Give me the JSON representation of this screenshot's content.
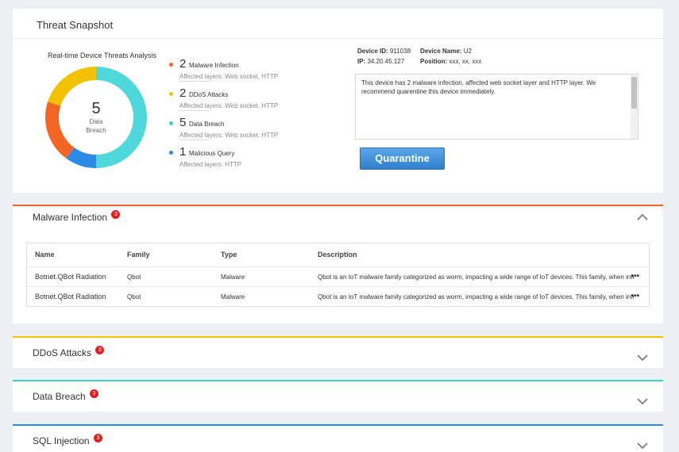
{
  "snapshot": {
    "title": "Threat Snapshot",
    "chart_data": {
      "type": "pie",
      "title": "Real-time Device Threats Analysis",
      "center_value": "5",
      "center_label_1": "Data",
      "center_label_2": "Breach",
      "slices": [
        {
          "name": "Data Breach",
          "value": 5,
          "color": "#4ed8dc"
        },
        {
          "name": "Malicious Query",
          "value": 1,
          "color": "#2b8ae6"
        },
        {
          "name": "Malware Infection",
          "value": 2,
          "color": "#f26522"
        },
        {
          "name": "DDoS Attacks",
          "value": 2,
          "color": "#f2c200"
        }
      ]
    },
    "legend": [
      {
        "count": "2",
        "name": "Malware Infection",
        "sub": "Affected layers: Web socket, HTTP",
        "color": "#f26522"
      },
      {
        "count": "2",
        "name": "DDoS Attacks",
        "sub": "Affected layers: Web socket, HTTP",
        "color": "#f2c200"
      },
      {
        "count": "5",
        "name": "Data Breach",
        "sub": "Affected layers: Web socket, HTTP",
        "color": "#3ccfd4"
      },
      {
        "count": "1",
        "name": "Malicious Query",
        "sub": "Affected layers: HTTP",
        "color": "#2b8ae6"
      }
    ],
    "device": {
      "id_label": "Device ID:",
      "id_value": "911038",
      "name_label": "Device Name:",
      "name_value": "U2",
      "ip_label": "IP:",
      "ip_value": "34.20.45.127",
      "pos_label": "Position:",
      "pos_value": "xxx, xx, xxx"
    },
    "description": "This device has 2 malware infection, affected web socket layer and HTTP layer. We recommend quarentine this device immediately.",
    "quarantine_label": "Quarantine"
  },
  "sections": {
    "malware": {
      "title": "Malware Infection",
      "badge": "3",
      "columns": {
        "name": "Name",
        "family": "Family",
        "type": "Type",
        "description": "Description"
      },
      "rows": [
        {
          "name": "Botnet.QBot Radiation",
          "family": "Qbot",
          "type": "Malware",
          "description": "Qbot is an IoT malware family categorized as worm, impacting a wide range of IoT devices. This family, when infect",
          "more": "•••"
        },
        {
          "name": "Botnet.QBot Radiation",
          "family": "Qbot",
          "type": "Malware",
          "description": "Qbot is an IoT malware family categorized as worm, impacting a wide range of IoT devices. This family, when infect",
          "more": "•••"
        }
      ]
    },
    "ddos": {
      "title": "DDoS Attacks",
      "badge": "3"
    },
    "breach": {
      "title": "Data Breach",
      "badge": "3"
    },
    "sql": {
      "title": "SQL Injection",
      "badge": "3"
    }
  }
}
